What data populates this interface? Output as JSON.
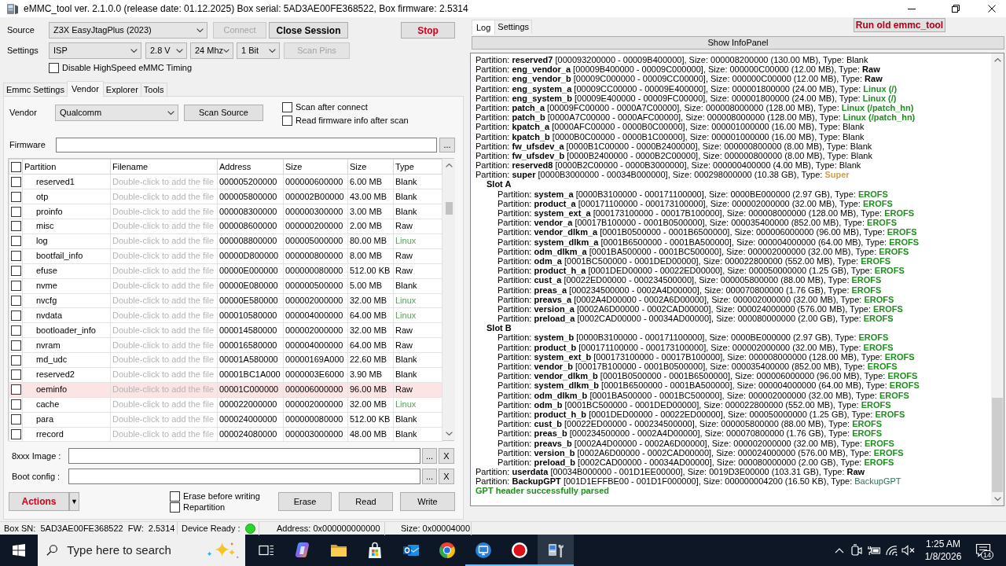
{
  "window": {
    "title": "eMMC_tool ver. 2.1.0.0 (release date: 01.12.2025) Box serial: 5AD3AE00FE368522, Box firmware: 2.5314"
  },
  "source": {
    "label": "Source",
    "device": "Z3X EasyJtagPlus (2023)",
    "buttons": [
      {
        "label": "Connect",
        "disabled": true
      },
      {
        "label": "Close Session",
        "kind": "bold",
        "disabled": false
      }
    ],
    "stop": {
      "label": "Stop",
      "kind": "danger"
    }
  },
  "settings": {
    "label": "Settings",
    "selects": [
      "ISP",
      "2.8 V",
      "24 Mhz",
      "1 Bit"
    ],
    "scan": {
      "label": "Scan Pins",
      "disabled": true
    }
  },
  "highspeed": {
    "label": "Disable HighSpeed eMMC Timing",
    "checked": false
  },
  "tabs": [
    {
      "label": "Emmc Settings",
      "selected": false
    },
    {
      "label": "Vendor",
      "selected": true
    },
    {
      "label": "Explorer",
      "selected": false
    },
    {
      "label": "Tools",
      "selected": false
    }
  ],
  "vendor": {
    "label": "Vendor",
    "value": "Qualcomm",
    "scan": {
      "label": "Scan Source"
    },
    "options": [
      {
        "label": "Scan after connect",
        "checked": false
      },
      {
        "label": "Read firmware info after scan",
        "checked": false
      }
    ]
  },
  "firmware": {
    "label": "Firmware",
    "browse": "..."
  },
  "table": {
    "all_checked": false,
    "columns": [
      "Partition",
      "Filename",
      "Address",
      "Size",
      "Size",
      "Type"
    ],
    "rows": [
      {
        "checked": false,
        "selected": false,
        "cells": [
          "reserved1",
          "Double-click to add the file",
          "000005200000",
          "000000600000",
          "6.00 MB",
          "Blank"
        ],
        "color": "#000000"
      },
      {
        "checked": false,
        "selected": false,
        "cells": [
          "otp",
          "Double-click to add the file",
          "000005800000",
          "000002B00000",
          "43.00 MB",
          "Blank"
        ],
        "color": "#000000"
      },
      {
        "checked": false,
        "selected": false,
        "cells": [
          "proinfo",
          "Double-click to add the file",
          "000008300000",
          "000000300000",
          "3.00 MB",
          "Blank"
        ],
        "color": "#000000"
      },
      {
        "checked": false,
        "selected": false,
        "cells": [
          "misc",
          "Double-click to add the file",
          "000008600000",
          "000000200000",
          "2.00 MB",
          "Raw"
        ],
        "color": "#000000"
      },
      {
        "checked": false,
        "selected": false,
        "cells": [
          "log",
          "Double-click to add the file",
          "000008800000",
          "000005000000",
          "80.00 MB",
          "Linux"
        ],
        "color": "#5c9c5c"
      },
      {
        "checked": false,
        "selected": false,
        "cells": [
          "bootfail_info",
          "Double-click to add the file",
          "00000D800000",
          "000000800000",
          "8.00 MB",
          "Raw"
        ],
        "color": "#000000"
      },
      {
        "checked": false,
        "selected": false,
        "cells": [
          "efuse",
          "Double-click to add the file",
          "00000E000000",
          "000000080000",
          "512.00 KB",
          "Raw"
        ],
        "color": "#000000"
      },
      {
        "checked": false,
        "selected": false,
        "cells": [
          "nvme",
          "Double-click to add the file",
          "00000E080000",
          "000000500000",
          "5.00 MB",
          "Blank"
        ],
        "color": "#000000"
      },
      {
        "checked": false,
        "selected": false,
        "cells": [
          "nvcfg",
          "Double-click to add the file",
          "00000E580000",
          "000002000000",
          "32.00 MB",
          "Linux"
        ],
        "color": "#5c9c5c"
      },
      {
        "checked": false,
        "selected": false,
        "cells": [
          "nvdata",
          "Double-click to add the file",
          "000010580000",
          "000004000000",
          "64.00 MB",
          "Linux"
        ],
        "color": "#5c9c5c"
      },
      {
        "checked": false,
        "selected": false,
        "cells": [
          "bootloader_info",
          "Double-click to add the file",
          "000014580000",
          "000002000000",
          "32.00 MB",
          "Raw"
        ],
        "color": "#000000"
      },
      {
        "checked": false,
        "selected": false,
        "cells": [
          "nvram",
          "Double-click to add the file",
          "000016580000",
          "000004000000",
          "64.00 MB",
          "Raw"
        ],
        "color": "#000000"
      },
      {
        "checked": false,
        "selected": false,
        "cells": [
          "md_udc",
          "Double-click to add the file",
          "00001A580000",
          "00000169A000",
          "22.60 MB",
          "Blank"
        ],
        "color": "#000000"
      },
      {
        "checked": false,
        "selected": false,
        "cells": [
          "reserved2",
          "Double-click to add the file",
          "00001BC1A000",
          "0000003E6000",
          "3.90 MB",
          "Blank"
        ],
        "color": "#000000"
      },
      {
        "checked": false,
        "selected": true,
        "cells": [
          "oeminfo",
          "Double-click to add the file",
          "00001C000000",
          "000006000000",
          "96.00 MB",
          "Raw"
        ],
        "color": "#000000"
      },
      {
        "checked": false,
        "selected": false,
        "cells": [
          "cache",
          "Double-click to add the file",
          "000022000000",
          "000002000000",
          "32.00 MB",
          "Linux"
        ],
        "color": "#5c9c5c"
      },
      {
        "checked": false,
        "selected": false,
        "cells": [
          "para",
          "Double-click to add the file",
          "000024000000",
          "000000080000",
          "512.00 KB",
          "Blank"
        ],
        "color": "#000000"
      },
      {
        "checked": false,
        "selected": false,
        "cells": [
          "rrecord",
          "Double-click to add the file",
          "000024080000",
          "000003000000",
          "48.00 MB",
          "Blank"
        ],
        "color": "#000000"
      }
    ]
  },
  "image_files": [
    {
      "label": "8xxx Image :",
      "browse": "...",
      "clear": "X"
    },
    {
      "label": "Boot config :",
      "browse": "...",
      "clear": "X"
    }
  ],
  "actions": {
    "button": {
      "label": "Actions",
      "kind": "danger"
    },
    "menu": {
      "label": "▼"
    },
    "options": [
      {
        "label": "Erase before writing",
        "checked": false
      },
      {
        "label": "Repartition",
        "checked": false
      }
    ],
    "buttons": [
      "Erase",
      "Read",
      "Write"
    ]
  },
  "status_bar": {
    "box": "Box SN:  5AD3AE00FE368522  FW:  2.5314",
    "device_label": "Device Ready :",
    "device_ready": true,
    "address": "Address: 0x000000000000",
    "size": "Size: 0x00004000"
  },
  "log_tabs": [
    {
      "label": "Log",
      "selected": true
    },
    {
      "label": "Settings",
      "selected": false
    }
  ],
  "run_old": {
    "label": "Run old emmc_tool",
    "kind": "danger"
  },
  "info_panel": "Show InfoPanel",
  "log": [
    {
      "kind": "partition",
      "text": "Partition: **reserved7** [000093200000 - 00009B400000], Size: 000008200000 (130.00 MB), Type: ",
      "type": "Blank",
      "color": "#000000"
    },
    {
      "kind": "partition",
      "text": "Partition: **eng_vendor_a** [00009B400000 - 00009C000000], Size: 000000C00000 (12.00 MB), Type: ",
      "type": "**Raw**",
      "color": "#000000"
    },
    {
      "kind": "partition",
      "text": "Partition: **eng_vendor_b** [00009C000000 - 00009CC00000], Size: 000000C00000 (12.00 MB), Type: ",
      "type": "**Raw**",
      "color": "#000000"
    },
    {
      "kind": "partition",
      "text": "Partition: **eng_system_a** [00009CC00000 - 00009E400000], Size: 000001800000 (24.00 MB), Type: ",
      "type": "**Linux (/)**",
      "color": "#1f8f1f"
    },
    {
      "kind": "partition",
      "text": "Partition: **eng_system_b** [00009E400000 - 00009FC00000], Size: 000001800000 (24.00 MB), Type: ",
      "type": "**Linux (/)**",
      "color": "#1f8f1f"
    },
    {
      "kind": "partition",
      "text": "Partition: **patch_a** [00009FC00000 - 0000A7C00000], Size: 000008000000 (128.00 MB), Type: ",
      "type": "**Linux (/patch_hn)**",
      "color": "#1f8f1f"
    },
    {
      "kind": "partition",
      "text": "Partition: **patch_b** [0000A7C00000 - 0000AFC00000], Size: 000008000000 (128.00 MB), Type: ",
      "type": "**Linux (/patch_hn)**",
      "color": "#1f8f1f"
    },
    {
      "kind": "partition",
      "text": "Partition: **kpatch_a** [0000AFC00000 - 0000B0C00000], Size: 000001000000 (16.00 MB), Type: ",
      "type": "Blank",
      "color": "#000000"
    },
    {
      "kind": "partition",
      "text": "Partition: **kpatch_b** [0000B0C00000 - 0000B1C00000], Size: 000001000000 (16.00 MB), Type: ",
      "type": "Blank",
      "color": "#000000"
    },
    {
      "kind": "partition",
      "text": "Partition: **fw_ufsdev_a** [0000B1C00000 - 0000B2400000], Size: 000000800000 (8.00 MB), Type: ",
      "type": "Blank",
      "color": "#000000"
    },
    {
      "kind": "partition",
      "text": "Partition: **fw_ufsdev_b** [0000B2400000 - 0000B2C00000], Size: 000000800000 (8.00 MB), Type: ",
      "type": "Blank",
      "color": "#000000"
    },
    {
      "kind": "partition",
      "text": "Partition: **reserved8** [0000B2C00000 - 0000B3000000], Size: 000000400000 (4.00 MB), Type: ",
      "type": "Blank",
      "color": "#000000"
    },
    {
      "kind": "partition",
      "text": "Partition: **super** [0000B3000000 - 00034B000000], Size: 000298000000 (10.38 GB), Type: ",
      "type": "**Super**",
      "color": "#cf9f4f"
    },
    {
      "kind": "group",
      "label": "Slot A",
      "children": [
        {
          "kind": "partition",
          "text": "Partition: **system_a** [0000B3100000 - 000171100000], Size: 0000BE000000 (2.97 GB), Type: ",
          "type": "**EROFS**",
          "color": "#1f8f1f"
        },
        {
          "kind": "partition",
          "text": "Partition: **product_a** [000171100000 - 000173100000], Size: 000002000000 (32.00 MB), Type: ",
          "type": "**EROFS**",
          "color": "#1f8f1f"
        },
        {
          "kind": "partition",
          "text": "Partition: **system_ext_a** [000173100000 - 00017B100000], Size: 000008000000 (128.00 MB), Type: ",
          "type": "**EROFS**",
          "color": "#1f8f1f"
        },
        {
          "kind": "partition",
          "text": "Partition: **vendor_a** [00017B100000 - 0001B0500000], Size: 000035400000 (852.00 MB), Type: ",
          "type": "**EROFS**",
          "color": "#1f8f1f"
        },
        {
          "kind": "partition",
          "text": "Partition: **vendor_dlkm_a** [0001B0500000 - 0001B6500000], Size: 000006000000 (96.00 MB), Type: ",
          "type": "**EROFS**",
          "color": "#1f8f1f"
        },
        {
          "kind": "partition",
          "text": "Partition: **system_dlkm_a** [0001B6500000 - 0001BA500000], Size: 000004000000 (64.00 MB), Type: ",
          "type": "**EROFS**",
          "color": "#1f8f1f"
        },
        {
          "kind": "partition",
          "text": "Partition: **odm_dlkm_a** [0001BA500000 - 0001BC500000], Size: 000002000000 (32.00 MB), Type: ",
          "type": "**EROFS**",
          "color": "#1f8f1f"
        },
        {
          "kind": "partition",
          "text": "Partition: **odm_a** [0001BC500000 - 0001DED00000], Size: 000022800000 (552.00 MB), Type: ",
          "type": "**EROFS**",
          "color": "#1f8f1f"
        },
        {
          "kind": "partition",
          "text": "Partition: **product_h_a** [0001DED00000 - 00022ED00000], Size: 000050000000 (1.25 GB), Type: ",
          "type": "**EROFS**",
          "color": "#1f8f1f"
        },
        {
          "kind": "partition",
          "text": "Partition: **cust_a** [00022ED00000 - 000234500000], Size: 000005800000 (88.00 MB), Type: ",
          "type": "**EROFS**",
          "color": "#1f8f1f"
        },
        {
          "kind": "partition",
          "text": "Partition: **preas_a** [000234500000 - 0002A4D00000], Size: 000070800000 (1.76 GB), Type: ",
          "type": "**EROFS**",
          "color": "#1f8f1f"
        },
        {
          "kind": "partition",
          "text": "Partition: **preavs_a** [0002A4D00000 - 0002A6D00000], Size: 000002000000 (32.00 MB), Type: ",
          "type": "**EROFS**",
          "color": "#1f8f1f"
        },
        {
          "kind": "partition",
          "text": "Partition: **version_a** [0002A6D00000 - 0002CAD00000], Size: 000024000000 (576.00 MB), Type: ",
          "type": "**EROFS**",
          "color": "#1f8f1f"
        },
        {
          "kind": "partition",
          "text": "Partition: **preload_a** [0002CAD00000 - 00034AD00000], Size: 000080000000 (2.00 GB), Type: ",
          "type": "**EROFS**",
          "color": "#1f8f1f"
        }
      ]
    },
    {
      "kind": "group",
      "label": "Slot B",
      "children": [
        {
          "kind": "partition",
          "text": "Partition: **system_b** [0000B3100000 - 000171100000], Size: 0000BE000000 (2.97 GB), Type: ",
          "type": "**EROFS**",
          "color": "#1f8f1f"
        },
        {
          "kind": "partition",
          "text": "Partition: **product_b** [000171100000 - 000173100000], Size: 000002000000 (32.00 MB), Type: ",
          "type": "**EROFS**",
          "color": "#1f8f1f"
        },
        {
          "kind": "partition",
          "text": "Partition: **system_ext_b** [000173100000 - 00017B100000], Size: 000008000000 (128.00 MB), Type: ",
          "type": "**EROFS**",
          "color": "#1f8f1f"
        },
        {
          "kind": "partition",
          "text": "Partition: **vendor_b** [00017B100000 - 0001B0500000], Size: 000035400000 (852.00 MB), Type: ",
          "type": "**EROFS**",
          "color": "#1f8f1f"
        },
        {
          "kind": "partition",
          "text": "Partition: **vendor_dlkm_b** [0001B0500000 - 0001B6500000], Size: 000006000000 (96.00 MB), Type: ",
          "type": "**EROFS**",
          "color": "#1f8f1f"
        },
        {
          "kind": "partition",
          "text": "Partition: **system_dlkm_b** [0001B6500000 - 0001BA500000], Size: 000004000000 (64.00 MB), Type: ",
          "type": "**EROFS**",
          "color": "#1f8f1f"
        },
        {
          "kind": "partition",
          "text": "Partition: **odm_dlkm_b** [0001BA500000 - 0001BC500000], Size: 000002000000 (32.00 MB), Type: ",
          "type": "**EROFS**",
          "color": "#1f8f1f"
        },
        {
          "kind": "partition",
          "text": "Partition: **odm_b** [0001BC500000 - 0001DED00000], Size: 000022800000 (552.00 MB), Type: ",
          "type": "**EROFS**",
          "color": "#1f8f1f"
        },
        {
          "kind": "partition",
          "text": "Partition: **product_h_b** [0001DED00000 - 00022ED00000], Size: 000050000000 (1.25 GB), Type: ",
          "type": "**EROFS**",
          "color": "#1f8f1f"
        },
        {
          "kind": "partition",
          "text": "Partition: **cust_b** [00022ED00000 - 000234500000], Size: 000005800000 (88.00 MB), Type: ",
          "type": "**EROFS**",
          "color": "#1f8f1f"
        },
        {
          "kind": "partition",
          "text": "Partition: **preas_b** [000234500000 - 0002A4D00000], Size: 000070800000 (1.76 GB), Type: ",
          "type": "**EROFS**",
          "color": "#1f8f1f"
        },
        {
          "kind": "partition",
          "text": "Partition: **preavs_b** [0002A4D00000 - 0002A6D00000], Size: 000002000000 (32.00 MB), Type: ",
          "type": "**EROFS**",
          "color": "#1f8f1f"
        },
        {
          "kind": "partition",
          "text": "Partition: **version_b** [0002A6D00000 - 0002CAD00000], Size: 000024000000 (576.00 MB), Type: ",
          "type": "**EROFS**",
          "color": "#1f8f1f"
        },
        {
          "kind": "partition",
          "text": "Partition: **preload_b** [0002CAD00000 - 00034AD00000], Size: 000080000000 (2.00 GB), Type: ",
          "type": "**EROFS**",
          "color": "#1f8f1f"
        }
      ]
    },
    {
      "kind": "partition",
      "text": "Partition: **userdata** [00034B000000 - 001D1EE00000], Size: 0019D3E00000 (103.31 GB), Type: ",
      "type": "**Raw**",
      "color": "#000000"
    },
    {
      "kind": "partition",
      "text": "Partition: **BackupGPT** [001D1EFFBE00 - 001D1F000000], Size: 000000004200 (16.50 KB), Type: ",
      "type": "BackupGPT",
      "color": "#2f6f5f"
    },
    {
      "kind": "message",
      "text": "GPT header successfully parsed",
      "color": "#1f8f1f"
    }
  ],
  "taskbar": {
    "search_placeholder": "Type here to search",
    "apps": [
      {
        "running": false,
        "active": false
      },
      {
        "running": false,
        "active": false
      },
      {
        "running": false,
        "active": false
      },
      {
        "running": false,
        "active": false
      },
      {
        "running": false,
        "active": false
      },
      {
        "running": false,
        "active": false
      },
      {
        "running": true,
        "active": false
      },
      {
        "running": true,
        "active": false
      },
      {
        "running": true,
        "active": true
      }
    ],
    "time": "1:25 AM",
    "date": "1/8/2026",
    "notifications": "14"
  }
}
